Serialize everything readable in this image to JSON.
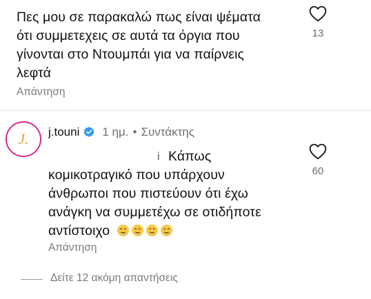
{
  "comment1": {
    "lines": [
      "Πες μου σε παρακαλώ πως είναι ψέματα",
      "ότι συμμετεχεις σε αυτά τα όργια που",
      "γίνονται στο Ντουμπάι για να παίρνεις",
      "λεφτά"
    ],
    "reply_label": "Απάντηση",
    "likes": "13"
  },
  "reply": {
    "avatar_letter": "J.",
    "username": "j.touni",
    "time": "1 ημ.",
    "separator": "•",
    "role": "Συντάκτης",
    "lines": [
      "Κάπως",
      "κομικοτραγικό που υπάρχουν",
      "άνθρωποι που πιστεύουν ότι έχω",
      "ανάγκη να συμμετέχω σε οτιδήποτε",
      "αντίστοιχο"
    ],
    "cursor_mark": "i",
    "emojis": [
      "drooling-face",
      "drooling-face",
      "drooling-face",
      "drooling-face"
    ],
    "reply_label": "Απάντηση",
    "likes": "60"
  },
  "more_replies": "Δείτε 12 ακόμη απαντήσεις",
  "colors": {
    "text": "#111111",
    "muted": "#7a7a7a",
    "verified_blue": "#3897f0",
    "avatar_ring": "#d32b8a",
    "avatar_letter": "#e6a23c"
  }
}
